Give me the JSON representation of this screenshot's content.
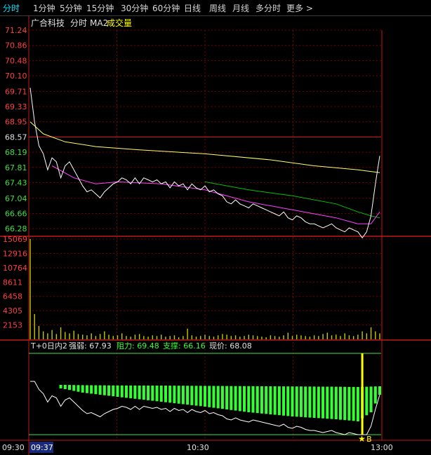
{
  "tabs": [
    "分时",
    "1分钟",
    "5分钟",
    "15分钟",
    "30分钟",
    "60分钟",
    "日线",
    "周线",
    "月线",
    "多分时",
    "更多 >"
  ],
  "active_tab": "分时",
  "header": {
    "stock_name": "广合科技",
    "mode": "分时",
    "ma_label": "MA2",
    "vol_label": "成交量"
  },
  "price_axis": {
    "ticks": [
      "71.24",
      "70.86",
      "70.48",
      "70.10",
      "69.71",
      "69.33",
      "68.95",
      "68.57",
      "68.19",
      "67.81",
      "67.43",
      "67.04",
      "66.66",
      "66.28"
    ],
    "prev_close": "68.57"
  },
  "volume_axis": {
    "ticks": [
      "15069",
      "12916",
      "10764",
      "8611",
      "6458",
      "4305",
      "2153"
    ]
  },
  "indicator": {
    "name": "T+0日内2",
    "strength_label": "强弱:",
    "strength": "67.93",
    "resistance_label": "阻力:",
    "resistance": "69.48",
    "support_label": "支撑:",
    "support": "66.16",
    "price_label": "现价:",
    "price": "68.08",
    "signal_mark": "B"
  },
  "time_axis": {
    "left": "09:30",
    "cursor": "09:37",
    "mid": "10:30",
    "right": "13:00"
  },
  "colors": {
    "bg": "#000000",
    "grid": "#7a0000",
    "frame": "#c01818",
    "up": "#ff4040",
    "down": "#40e040",
    "price": "#ffffff",
    "avg": "#ffff66",
    "ma_magenta": "#ff40ff",
    "ma_green": "#00c000",
    "volume": "#c8c800",
    "bars": "#33ff33",
    "signal": "#ffff00",
    "tab_active": "#00e5ff"
  },
  "chart_data": {
    "type": "line",
    "x_range": [
      "09:30",
      "13:00"
    ],
    "ylim": [
      66.09,
      71.24
    ],
    "volume_ylim": [
      0,
      15069
    ],
    "indicator_ylim": [
      66.16,
      69.48
    ],
    "price": [
      [
        0,
        69.8
      ],
      [
        1,
        68.95
      ],
      [
        2,
        68.35
      ],
      [
        3,
        68.15
      ],
      [
        4,
        67.75
      ],
      [
        5,
        68.05
      ],
      [
        6,
        67.95
      ],
      [
        7,
        67.55
      ],
      [
        8,
        67.85
      ],
      [
        9,
        67.95
      ],
      [
        10,
        67.75
      ],
      [
        11,
        67.55
      ],
      [
        12,
        67.35
      ],
      [
        13,
        67.2
      ],
      [
        14,
        67.25
      ],
      [
        15,
        67.15
      ],
      [
        16,
        67.05
      ],
      [
        17,
        67.2
      ],
      [
        18,
        67.3
      ],
      [
        19,
        67.4
      ],
      [
        20,
        67.45
      ],
      [
        21,
        67.55
      ],
      [
        22,
        67.5
      ],
      [
        23,
        67.4
      ],
      [
        24,
        67.55
      ],
      [
        25,
        67.4
      ],
      [
        26,
        67.55
      ],
      [
        27,
        67.5
      ],
      [
        28,
        67.45
      ],
      [
        29,
        67.5
      ],
      [
        30,
        67.4
      ],
      [
        31,
        67.45
      ],
      [
        32,
        67.3
      ],
      [
        33,
        67.45
      ],
      [
        34,
        67.35
      ],
      [
        35,
        67.4
      ],
      [
        36,
        67.25
      ],
      [
        37,
        67.4
      ],
      [
        38,
        67.3
      ],
      [
        39,
        67.25
      ],
      [
        40,
        67.35
      ],
      [
        41,
        67.2
      ],
      [
        42,
        67.25
      ],
      [
        43,
        67.15
      ],
      [
        44,
        67.1
      ],
      [
        45,
        66.95
      ],
      [
        46,
        66.9
      ],
      [
        47,
        67.0
      ],
      [
        48,
        66.9
      ],
      [
        49,
        66.85
      ],
      [
        50,
        66.8
      ],
      [
        51,
        66.9
      ],
      [
        52,
        66.85
      ],
      [
        53,
        66.8
      ],
      [
        54,
        66.75
      ],
      [
        55,
        66.7
      ],
      [
        56,
        66.65
      ],
      [
        57,
        66.6
      ],
      [
        58,
        66.7
      ],
      [
        59,
        66.55
      ],
      [
        60,
        66.5
      ],
      [
        61,
        66.6
      ],
      [
        62,
        66.55
      ],
      [
        63,
        66.45
      ],
      [
        64,
        66.4
      ],
      [
        65,
        66.4
      ],
      [
        66,
        66.35
      ],
      [
        67,
        66.3
      ],
      [
        68,
        66.35
      ],
      [
        69,
        66.4
      ],
      [
        70,
        66.3
      ],
      [
        71,
        66.25
      ],
      [
        72,
        66.2
      ],
      [
        73,
        66.3
      ],
      [
        74,
        66.25
      ],
      [
        75,
        66.2
      ],
      [
        76,
        66.05
      ],
      [
        77,
        66.2
      ],
      [
        78,
        66.6
      ],
      [
        79,
        67.4
      ],
      [
        80,
        68.1
      ]
    ],
    "avg_price": [
      [
        0,
        68.95
      ],
      [
        3,
        68.65
      ],
      [
        8,
        68.45
      ],
      [
        15,
        68.33
      ],
      [
        25,
        68.25
      ],
      [
        40,
        68.15
      ],
      [
        55,
        68.0
      ],
      [
        65,
        67.85
      ],
      [
        75,
        67.75
      ],
      [
        80,
        67.68
      ]
    ],
    "ma_magenta": [
      [
        5,
        67.85
      ],
      [
        10,
        67.55
      ],
      [
        15,
        67.4
      ],
      [
        20,
        67.45
      ],
      [
        30,
        67.4
      ],
      [
        40,
        67.25
      ],
      [
        50,
        66.95
      ],
      [
        60,
        66.75
      ],
      [
        70,
        66.55
      ],
      [
        75,
        66.4
      ],
      [
        78,
        66.4
      ],
      [
        80,
        66.7
      ]
    ],
    "ma_green": [
      [
        40,
        67.45
      ],
      [
        50,
        67.25
      ],
      [
        60,
        67.1
      ],
      [
        70,
        66.9
      ],
      [
        75,
        66.7
      ],
      [
        78,
        66.6
      ],
      [
        80,
        66.55
      ]
    ],
    "volume": [
      [
        0,
        15069
      ],
      [
        1,
        3800
      ],
      [
        2,
        2000
      ],
      [
        3,
        1200
      ],
      [
        4,
        900
      ],
      [
        5,
        1400
      ],
      [
        6,
        800
      ],
      [
        7,
        1800
      ],
      [
        8,
        1100
      ],
      [
        9,
        900
      ],
      [
        10,
        1300
      ],
      [
        11,
        800
      ],
      [
        12,
        700
      ],
      [
        13,
        600
      ],
      [
        14,
        900
      ],
      [
        15,
        500
      ],
      [
        16,
        800
      ],
      [
        17,
        1200
      ],
      [
        18,
        700
      ],
      [
        19,
        500
      ],
      [
        20,
        600
      ],
      [
        21,
        900
      ],
      [
        22,
        500
      ],
      [
        23,
        400
      ],
      [
        24,
        700
      ],
      [
        25,
        800
      ],
      [
        26,
        500
      ],
      [
        27,
        400
      ],
      [
        28,
        600
      ],
      [
        29,
        500
      ],
      [
        30,
        700
      ],
      [
        31,
        400
      ],
      [
        32,
        500
      ],
      [
        33,
        600
      ],
      [
        34,
        300
      ],
      [
        35,
        500
      ],
      [
        36,
        1600
      ],
      [
        37,
        600
      ],
      [
        38,
        400
      ],
      [
        39,
        500
      ],
      [
        40,
        700
      ],
      [
        41,
        500
      ],
      [
        42,
        400
      ],
      [
        43,
        600
      ],
      [
        44,
        800
      ],
      [
        45,
        700
      ],
      [
        46,
        500
      ],
      [
        47,
        600
      ],
      [
        48,
        400
      ],
      [
        49,
        500
      ],
      [
        50,
        700
      ],
      [
        51,
        600
      ],
      [
        52,
        500
      ],
      [
        53,
        400
      ],
      [
        54,
        300
      ],
      [
        55,
        600
      ],
      [
        56,
        500
      ],
      [
        57,
        400
      ],
      [
        58,
        600
      ],
      [
        59,
        1000
      ],
      [
        60,
        500
      ],
      [
        61,
        700
      ],
      [
        62,
        600
      ],
      [
        63,
        500
      ],
      [
        64,
        400
      ],
      [
        65,
        600
      ],
      [
        66,
        500
      ],
      [
        67,
        800
      ],
      [
        68,
        1000
      ],
      [
        69,
        600
      ],
      [
        70,
        700
      ],
      [
        71,
        500
      ],
      [
        72,
        900
      ],
      [
        73,
        600
      ],
      [
        74,
        500
      ],
      [
        75,
        700
      ],
      [
        76,
        1200
      ],
      [
        77,
        900
      ],
      [
        78,
        1800
      ],
      [
        79,
        1200
      ],
      [
        80,
        900
      ]
    ],
    "indicator_bars": [
      [
        0,
        2,
        2
      ],
      [
        3,
        3,
        3
      ],
      [
        5,
        4,
        4
      ],
      [
        8,
        5,
        7
      ],
      [
        12,
        7,
        12
      ],
      [
        20,
        9,
        18
      ],
      [
        30,
        10,
        25
      ],
      [
        40,
        12,
        32
      ],
      [
        50,
        14,
        40
      ],
      [
        60,
        16,
        46
      ],
      [
        70,
        18,
        50
      ],
      [
        75,
        20,
        53
      ],
      [
        78,
        17,
        40
      ],
      [
        80,
        15,
        15
      ]
    ],
    "signals": [
      {
        "x": 76,
        "label": "B"
      }
    ]
  }
}
